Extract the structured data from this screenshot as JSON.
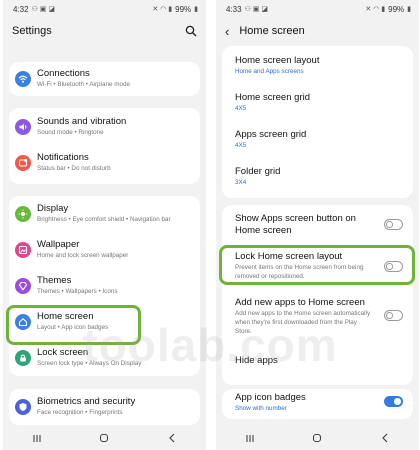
{
  "left": {
    "status": {
      "time": "4:32",
      "battery": "99%"
    },
    "title": "Settings",
    "items": [
      {
        "title": "Connections",
        "sub": "Wi-Fi  •  Bluetooth  •  Airplane mode",
        "color": "#3b82e0"
      },
      {
        "title": "Sounds and vibration",
        "sub": "Sound mode  •  Ringtone",
        "color": "#8a5be0"
      },
      {
        "title": "Notifications",
        "sub": "Status bar  •  Do not disturb",
        "color": "#ef5a4b"
      },
      {
        "title": "Display",
        "sub": "Brightness  •  Eye comfort shield  •  Navigation bar",
        "color": "#66b93a"
      },
      {
        "title": "Wallpaper",
        "sub": "Home and lock screen wallpaper",
        "color": "#e0478a"
      },
      {
        "title": "Themes",
        "sub": "Themes  •  Wallpapers  •  Icons",
        "color": "#9b4fd6"
      },
      {
        "title": "Home screen",
        "sub": "Layout  •  App icon badges",
        "color": "#3b82e0"
      },
      {
        "title": "Lock screen",
        "sub": "Screen lock type  •  Always On Display",
        "color": "#2fa37a"
      },
      {
        "title": "Biometrics and security",
        "sub": "Face recognition  •  Fingerprints",
        "color": "#4a63d8"
      }
    ]
  },
  "right": {
    "status": {
      "time": "4:33",
      "battery": "99%"
    },
    "title": "Home screen",
    "grid_items": [
      {
        "title": "Home screen layout",
        "sub": "Home and Apps screens"
      },
      {
        "title": "Home screen grid",
        "sub": "4X5"
      },
      {
        "title": "Apps screen grid",
        "sub": "4X5"
      },
      {
        "title": "Folder grid",
        "sub": "3X4"
      }
    ],
    "toggle_items": [
      {
        "title1": "Show Apps screen button on",
        "title2": "Home screen",
        "on": false
      },
      {
        "title1": "Lock Home screen layout",
        "sub1": "Prevent items on the Home screen from being",
        "sub2": "removed or repositioned.",
        "on": false
      },
      {
        "title1": "Add new apps to Home screen",
        "sub1": "Add new apps to the Home screen automatically",
        "sub2": "when they're first downloaded from the Play",
        "sub3": "Store.",
        "on": false
      }
    ],
    "hide_apps": "Hide apps",
    "badges": {
      "title": "App icon badges",
      "sub": "Show with number",
      "on": true
    }
  },
  "watermark": "toolab.com",
  "colors": {
    "highlight": "#6fb33a",
    "accent": "#2f7ce6",
    "link": "#2a6fd6"
  }
}
